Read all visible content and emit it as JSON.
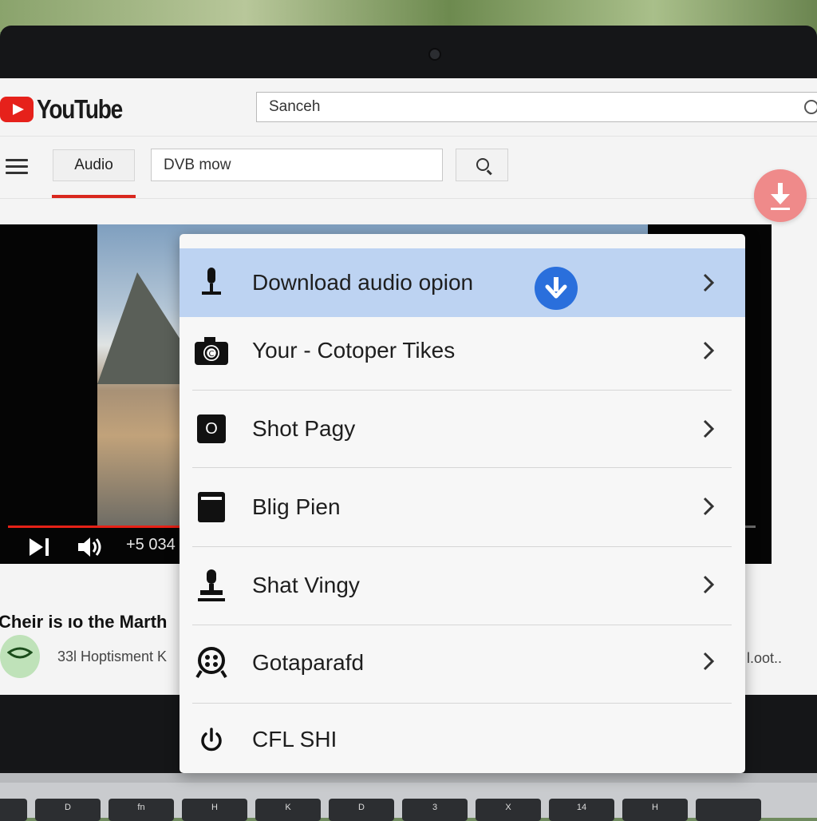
{
  "header": {
    "brand": "YouTube",
    "search_value": "Sanceh"
  },
  "toolbar": {
    "tab_label": "Audio",
    "search_value": "DVB mow"
  },
  "video": {
    "time": "+5 034"
  },
  "below": {
    "title": "Cheir is ıo the Marth",
    "channel_meta": "33l Hoptisment K",
    "right_meta": "l.oot.."
  },
  "menu": {
    "items": [
      {
        "label": "Download audio opion",
        "icon": "microphone-icon",
        "chevron": true
      },
      {
        "label": "Your - Cotoper Tikes",
        "icon": "camera-icon",
        "chevron": true
      },
      {
        "label": "Shot Pagy",
        "icon": "square-o-icon",
        "chevron": true
      },
      {
        "label": "Blig Pien",
        "icon": "tablet-icon",
        "chevron": true
      },
      {
        "label": "Shat Vingy",
        "icon": "stamp-icon",
        "chevron": true
      },
      {
        "label": "Gotaparafd",
        "icon": "film-reel-icon",
        "chevron": true
      },
      {
        "label": "CFL SHI",
        "icon": "power-icon",
        "chevron": false
      }
    ],
    "square_icon_text": "O"
  },
  "keyboard": {
    "keys": [
      "",
      "D",
      "fn",
      "H",
      "K",
      "D",
      "3",
      "X",
      "14",
      "H",
      ""
    ]
  },
  "colors": {
    "yt_red": "#e6211b",
    "menu_active": "#bdd3f2",
    "download_badge": "#2a6fdc",
    "float_button": "#ef8a8a"
  }
}
